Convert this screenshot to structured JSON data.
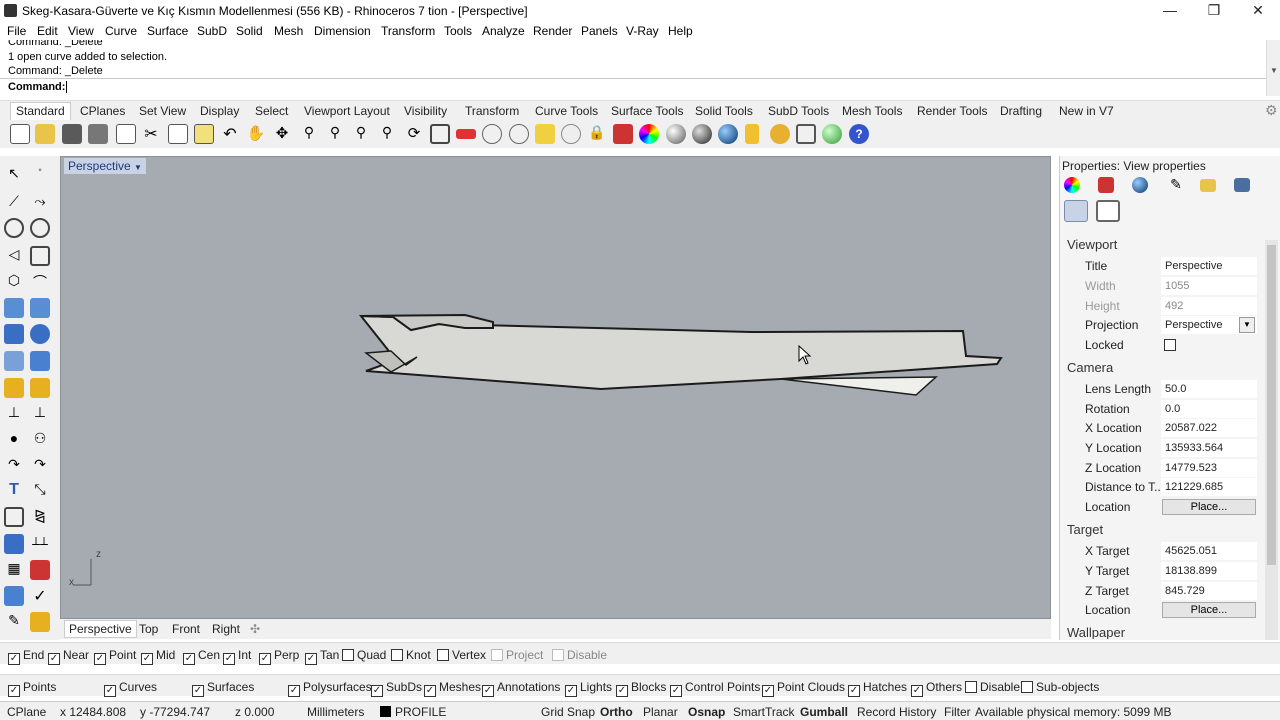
{
  "window": {
    "title": "Skeg-Kasara-Güverte ve Kıç Kısmın Modellenmesi (556 KB) - Rhinoceros 7 tion - [Perspective]",
    "minimize": "—",
    "maximize": "❐",
    "close": "✕"
  },
  "menu": [
    "File",
    "Edit",
    "View",
    "Curve",
    "Surface",
    "SubD",
    "Solid",
    "Mesh",
    "Dimension",
    "Transform",
    "Tools",
    "Analyze",
    "Render",
    "Panels",
    "V-Ray",
    "Help"
  ],
  "command": {
    "history": [
      "Command: _Delete",
      "1 open curve added to selection.",
      "Command: _Delete"
    ],
    "prompt": "Command:"
  },
  "toolbar_tabs": [
    "Standard",
    "CPlanes",
    "Set View",
    "Display",
    "Select",
    "Viewport Layout",
    "Visibility",
    "Transform",
    "Curve Tools",
    "Surface Tools",
    "Solid Tools",
    "SubD Tools",
    "Mesh Tools",
    "Render Tools",
    "Drafting",
    "New in V7"
  ],
  "viewport": {
    "label": "Perspective",
    "axis_z": "z",
    "axis_x": "x",
    "bottom_tabs": [
      "Perspective",
      "Top",
      "Front",
      "Right"
    ]
  },
  "properties": {
    "header": "Properties: View properties",
    "viewport_section": "Viewport",
    "title_label": "Title",
    "title_value": "Perspective",
    "width_label": "Width",
    "width_value": "1055",
    "height_label": "Height",
    "height_value": "492",
    "projection_label": "Projection",
    "projection_value": "Perspective",
    "locked_label": "Locked",
    "camera_section": "Camera",
    "lens_label": "Lens Length",
    "lens_value": "50.0",
    "rotation_label": "Rotation",
    "rotation_value": "0.0",
    "xloc_label": "X Location",
    "xloc_value": "20587.022",
    "yloc_label": "Y Location",
    "yloc_value": "135933.564",
    "zloc_label": "Z Location",
    "zloc_value": "14779.523",
    "dist_label": "Distance to T...",
    "dist_value": "121229.685",
    "loc_label": "Location",
    "place": "Place...",
    "target_section": "Target",
    "xt_label": "X Target",
    "xt_value": "45625.051",
    "yt_label": "Y Target",
    "yt_value": "18138.899",
    "zt_label": "Z Target",
    "zt_value": "845.729",
    "tloc_label": "Location",
    "wallpaper_section": "Wallpaper"
  },
  "osnap": [
    {
      "label": "End",
      "checked": true
    },
    {
      "label": "Near",
      "checked": true
    },
    {
      "label": "Point",
      "checked": true
    },
    {
      "label": "Mid",
      "checked": true
    },
    {
      "label": "Cen",
      "checked": true
    },
    {
      "label": "Int",
      "checked": true
    },
    {
      "label": "Perp",
      "checked": true
    },
    {
      "label": "Tan",
      "checked": true
    },
    {
      "label": "Quad",
      "checked": false
    },
    {
      "label": "Knot",
      "checked": false
    },
    {
      "label": "Vertex",
      "checked": false
    },
    {
      "label": "Project",
      "checked": false,
      "disabled": true
    },
    {
      "label": "Disable",
      "checked": false,
      "disabled": true
    }
  ],
  "filters": [
    {
      "label": "Points",
      "checked": true
    },
    {
      "label": "Curves",
      "checked": true
    },
    {
      "label": "Surfaces",
      "checked": true
    },
    {
      "label": "Polysurfaces",
      "checked": true
    },
    {
      "label": "SubDs",
      "checked": true
    },
    {
      "label": "Meshes",
      "checked": true
    },
    {
      "label": "Annotations",
      "checked": true
    },
    {
      "label": "Lights",
      "checked": true
    },
    {
      "label": "Blocks",
      "checked": true
    },
    {
      "label": "Control Points",
      "checked": true
    },
    {
      "label": "Point Clouds",
      "checked": true
    },
    {
      "label": "Hatches",
      "checked": true
    },
    {
      "label": "Others",
      "checked": true
    },
    {
      "label": "Disable",
      "checked": false
    },
    {
      "label": "Sub-objects",
      "checked": false
    }
  ],
  "status": {
    "cplane": "CPlane",
    "x": "x 12484.808",
    "y": "y -77294.747",
    "z": "z 0.000",
    "units": "Millimeters",
    "layer": "PROFILE",
    "grid_snap": "Grid Snap",
    "ortho": "Ortho",
    "planar": "Planar",
    "osnap": "Osnap",
    "smarttrack": "SmartTrack",
    "gumball": "Gumball",
    "record": "Record History",
    "filter": "Filter",
    "memory": "Available physical memory: 5099 MB"
  },
  "colors": {
    "viewport_bg": "#a6abb1",
    "hull": "#d8d8d4"
  }
}
